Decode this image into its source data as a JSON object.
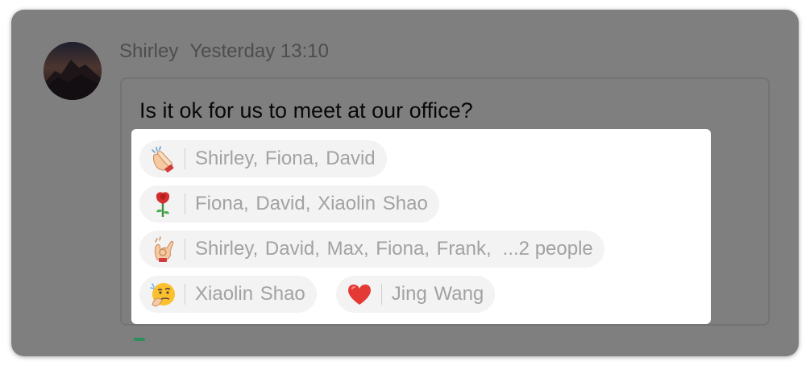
{
  "message": {
    "sender": "Shirley",
    "time": "Yesterday 13:10",
    "text": "Is it ok for us to meet at our office?"
  },
  "reactions": [
    {
      "emoji": "clapping-hands-icon",
      "names": "Shirley, Fiona, David",
      "more": ""
    },
    {
      "emoji": "rose-icon",
      "names": "Fiona, David, Xiaolin Shao",
      "more": ""
    },
    {
      "emoji": "ok-hand-icon",
      "names": "Shirley, David, Max, Fiona, Frank,",
      "more": "...2 people"
    },
    {
      "emoji": "thinking-face-icon",
      "names": "Xiaolin Shao",
      "more": ""
    },
    {
      "emoji": "red-heart-icon",
      "names": "Jing Wang",
      "more": ""
    }
  ],
  "colors": {
    "overlay": "#000000",
    "pill_bg": "#f3f3f3",
    "name_text": "#a2a2a2",
    "heart": "#e53935",
    "rose": "#d32f2f"
  }
}
